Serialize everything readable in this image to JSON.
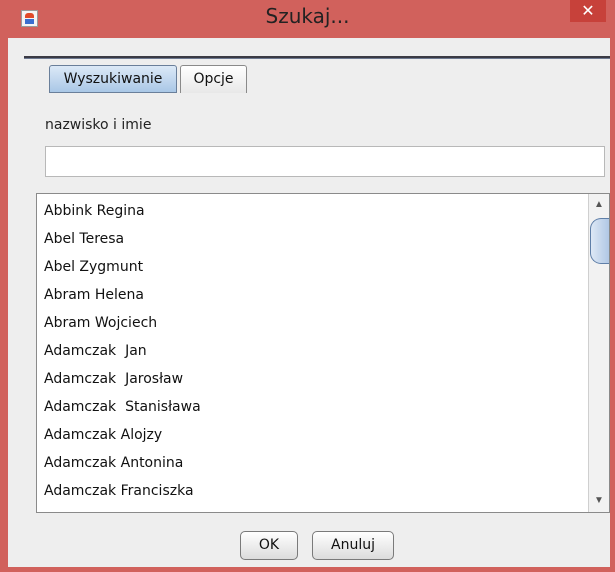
{
  "window": {
    "title": "Szukaj...",
    "close_glyph": "✕",
    "app_icon": "java-icon",
    "accent_color": "#d1615c"
  },
  "tabs": [
    {
      "label": "Wyszukiwanie",
      "selected": true
    },
    {
      "label": "Opcje",
      "selected": false
    }
  ],
  "search": {
    "label": "nazwisko i imie",
    "value": "",
    "placeholder": ""
  },
  "results": {
    "items": [
      "Abbink Regina",
      "Abel Teresa",
      "Abel Zygmunt",
      "Abram Helena",
      "Abram Wojciech",
      "Adamczak  Jan",
      "Adamczak  Jarosław",
      "Adamczak  Stanisława",
      "Adamczak Alojzy",
      "Adamczak Antonina",
      "Adamczak Franciszka"
    ],
    "scroll_up_glyph": "▲",
    "scroll_down_glyph": "▼"
  },
  "buttons": {
    "ok": "OK",
    "cancel": "Anuluj"
  }
}
